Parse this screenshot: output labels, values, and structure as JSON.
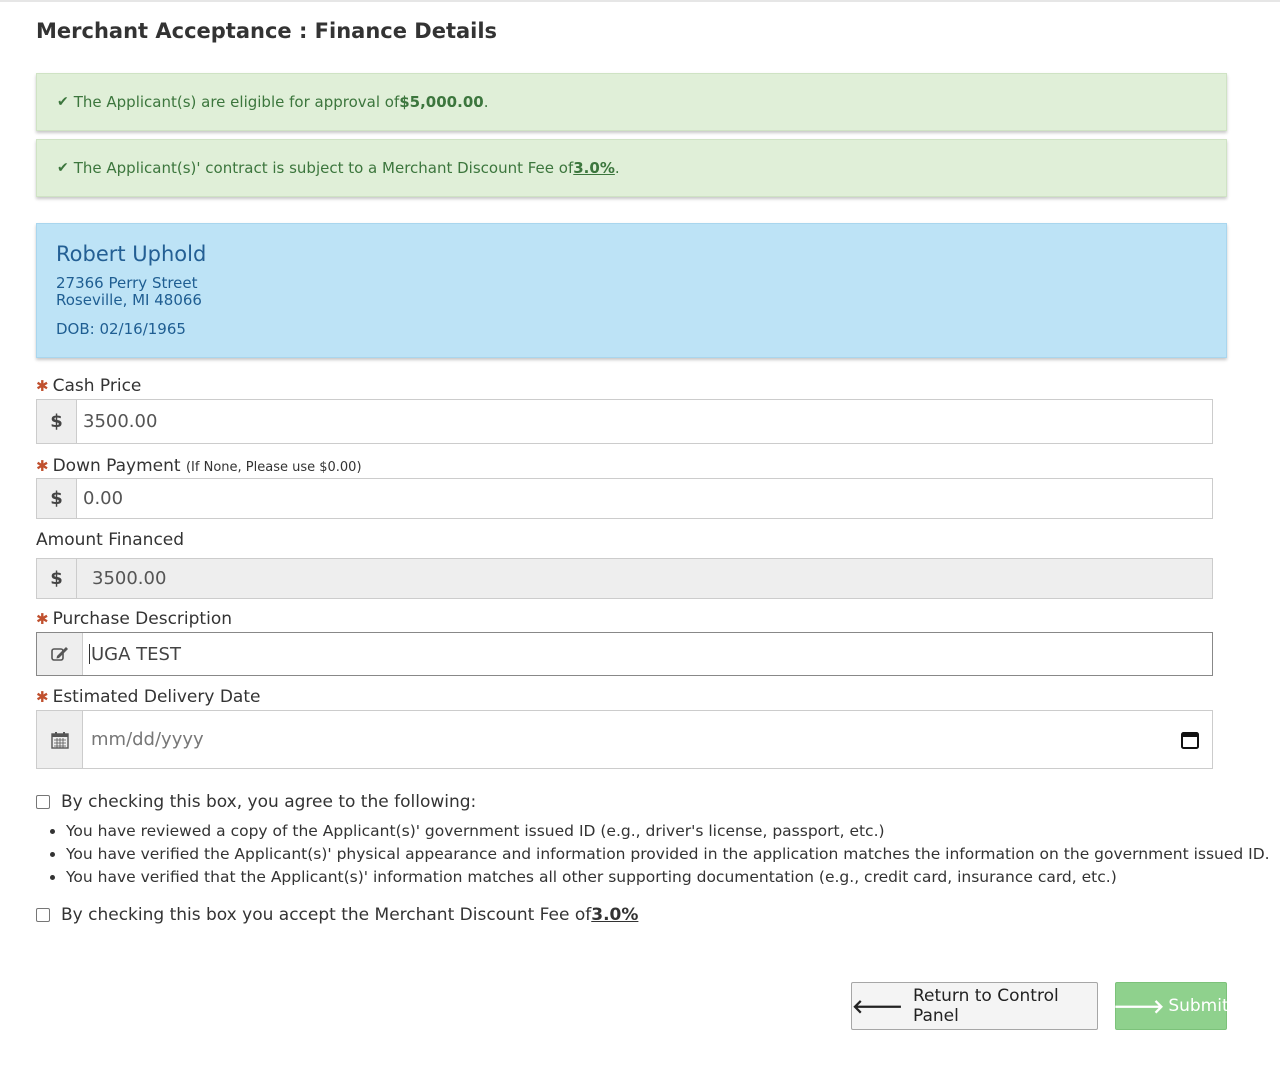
{
  "page": {
    "title": "Merchant Acceptance : Finance Details"
  },
  "alerts": {
    "approval": {
      "prefix": "The Applicant(s) are eligible for approval of ",
      "amount": "$5,000.00",
      "suffix": "."
    },
    "fee": {
      "prefix": "The Applicant(s)' contract is subject to a Merchant Discount Fee of ",
      "rate": "3.0%",
      "suffix": "."
    }
  },
  "applicant": {
    "name": "Robert Uphold",
    "street": "27366 Perry Street",
    "city_state_zip": "Roseville, MI 48066",
    "dob": "DOB: 02/16/1965"
  },
  "form": {
    "required_mark": "✱",
    "cash_price": {
      "label": "Cash Price",
      "addon": "$",
      "value": "3500.00"
    },
    "down_payment": {
      "label": "Down Payment",
      "hint": "(If None, Please use $0.00)",
      "addon": "$",
      "value": "0.00"
    },
    "amount_financed": {
      "label": "Amount Financed",
      "addon": "$",
      "value": "3500.00"
    },
    "purchase_description": {
      "label": "Purchase Description",
      "value": "UGA TEST"
    },
    "delivery_date": {
      "label": "Estimated Delivery Date",
      "placeholder": "mm/dd/yyyy"
    }
  },
  "agreement": {
    "checkbox_label": "By checking this box, you agree to the following:",
    "terms": [
      "You have reviewed a copy of the Applicant(s)' government issued ID (e.g., driver's license, passport, etc.)",
      "You have verified the Applicant(s)' physical appearance and information provided in the application matches the information on the government issued ID.",
      "You have verified that the Applicant(s)' information matches all other supporting documentation (e.g., credit card, insurance card, etc.)"
    ],
    "fee_checkbox_prefix": "By checking this box you accept the Merchant Discount Fee of ",
    "fee_rate": "3.0%"
  },
  "buttons": {
    "return_label": "Return to Control Panel",
    "submit_label": "Submit"
  },
  "colors": {
    "success_bg": "#e0efd8",
    "success_text": "#3c763d",
    "info_bg": "#bde3f6",
    "required": "#c0502e",
    "submit_bg": "#8fd18d"
  }
}
